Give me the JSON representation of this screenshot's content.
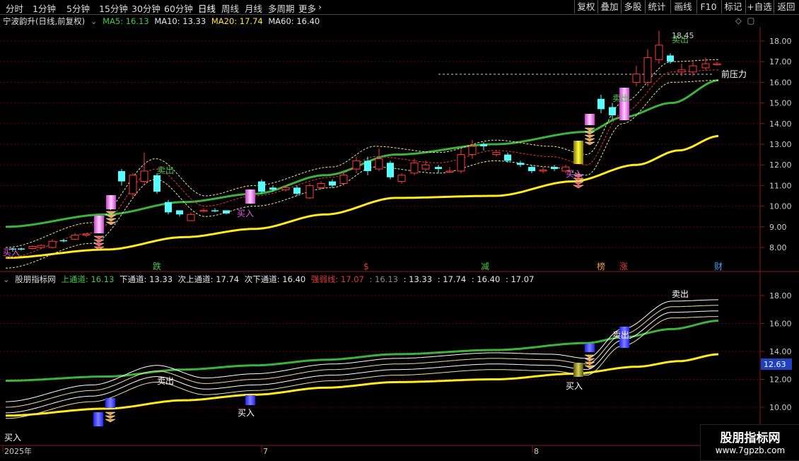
{
  "topbar": {
    "periods": [
      "分时",
      "1分钟",
      "5分钟",
      "15分钟",
      "30分钟",
      "60分钟",
      "日线",
      "周线",
      "月线",
      "多周期",
      "更多"
    ],
    "active_period": "日线",
    "tools": [
      "复权",
      "叠加",
      "多股",
      "统计",
      "画线",
      "F10",
      "标记",
      "+自选",
      "返回"
    ]
  },
  "main_panel": {
    "stock_name": "宁波韵升(日线,前复权)",
    "ma": [
      {
        "label": "MA5: 16.13",
        "color": "#46c946"
      },
      {
        "label": "MA10: 13.33",
        "color": "#e8e8e8"
      },
      {
        "label": "MA20: 17.74",
        "color": "#ffea3c"
      },
      {
        "label": "MA60: 16.40",
        "color": "#e8e8e8"
      }
    ],
    "y_ticks": [
      "18.00",
      "17.00",
      "16.00",
      "15.00",
      "14.00",
      "13.00",
      "12.00",
      "11.00",
      "10.00",
      "9.00",
      "8.00"
    ],
    "annotations": {
      "sell_1": "卖出",
      "sell_2": "卖出",
      "sell_3": "卖出",
      "buy_1": "买入",
      "buy_2": "买入",
      "buy_3": "买入",
      "peak": "18.45",
      "resistance": "前压力"
    },
    "event_tags": [
      {
        "text": "跌",
        "color": "#46c946"
      },
      {
        "text": "$",
        "color": "#e03a3a"
      },
      {
        "text": "减",
        "color": "#46c946"
      },
      {
        "text": "榜",
        "color": "#e0a04a"
      },
      {
        "text": "涨",
        "color": "#e03a3a"
      },
      {
        "text": "财",
        "color": "#40a0ff"
      }
    ]
  },
  "sub_panel": {
    "name": "股朋指标网",
    "indicators": [
      {
        "label": "上通道: 16.13",
        "color": "#46c946"
      },
      {
        "label": "下通道: 13.33",
        "color": "#e8e8e8"
      },
      {
        "label": "次上通道: 17.74",
        "color": "#e8e8e8"
      },
      {
        "label": "次下通道: 16.40",
        "color": "#e8e8e8"
      },
      {
        "label": "强弱线: 17.07",
        "color": "#e03a3a"
      },
      {
        "label": ": 16.13",
        "color": "#888888"
      },
      {
        "label": ": 13.33",
        "color": "#e8e8e8"
      },
      {
        "label": ": 17.74",
        "color": "#e8e8e8"
      },
      {
        "label": ": 16.40",
        "color": "#e8e8e8"
      },
      {
        "label": ": 17.07",
        "color": "#e8e8e8"
      }
    ],
    "y_ticks": [
      "18.00",
      "16.00",
      "14.00",
      "12.00",
      "10.00"
    ],
    "cursor_value": "12.63",
    "annotations": {
      "sell_1": "卖出",
      "sell_2": "卖出",
      "sell_3": "卖出",
      "buy_1": "买入",
      "buy_2": "买入",
      "buy_3": "买入"
    }
  },
  "time_axis": [
    "2025年",
    "7",
    "8"
  ],
  "watermark": {
    "title": "股朋指标网",
    "url": "www.7gpzb.com"
  },
  "colors": {
    "up": "#ff3c3c",
    "down": "#54ffff",
    "ma_green": "#3cb43c",
    "ma_yellow": "#ffea1e",
    "grid": "#8b0000",
    "axis": "#8b1a1a"
  }
}
